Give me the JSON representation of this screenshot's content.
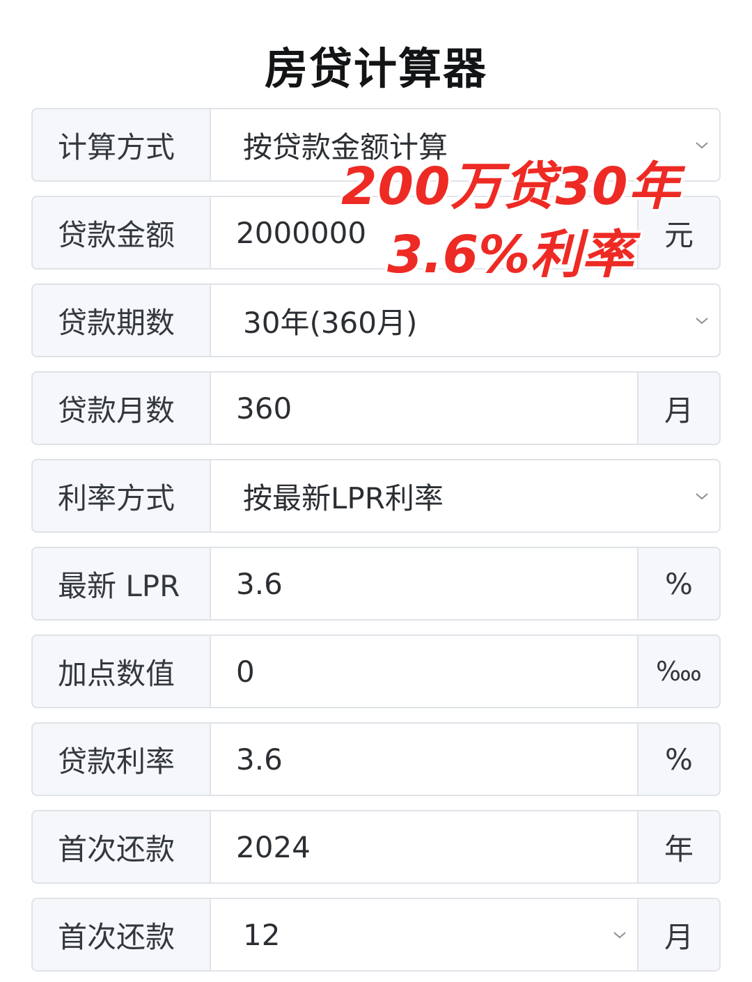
{
  "title": "房贷计算器",
  "overlay": {
    "line1": "200万贷30年",
    "line2": "3.6%利率",
    "color": "#ee2a24"
  },
  "rows": [
    {
      "label": "计算方式",
      "value": "按贷款金额计算",
      "type": "select"
    },
    {
      "label": "贷款金额",
      "value": "2000000",
      "unit": "元",
      "type": "input"
    },
    {
      "label": "贷款期数",
      "value": "30年(360月)",
      "type": "select"
    },
    {
      "label": "贷款月数",
      "value": "360",
      "unit": "月",
      "type": "input"
    },
    {
      "label": "利率方式",
      "value": "按最新LPR利率",
      "type": "select"
    },
    {
      "label": "最新 LPR",
      "value": "3.6",
      "unit": "%",
      "type": "input"
    },
    {
      "label": "加点数值",
      "value": "0",
      "unit": "‱",
      "type": "input"
    },
    {
      "label": "贷款利率",
      "value": "3.6",
      "unit": "%",
      "type": "input"
    },
    {
      "label": "首次还款",
      "value": "2024",
      "unit": "年",
      "type": "input"
    },
    {
      "label": "首次还款",
      "value": "12",
      "unit": "月",
      "type": "select"
    }
  ],
  "icons": {
    "dropdown": "chevron-down-icon"
  }
}
